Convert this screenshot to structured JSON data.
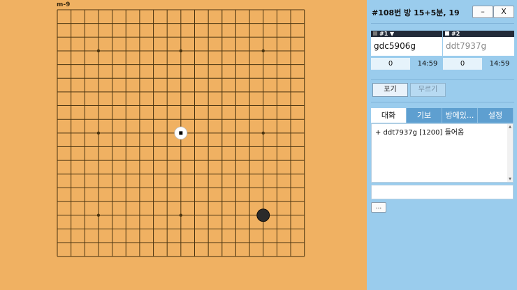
{
  "board": {
    "move_label": "m-9",
    "size": 19,
    "star_points": [
      [
        3,
        3
      ],
      [
        9,
        3
      ],
      [
        15,
        3
      ],
      [
        3,
        9
      ],
      [
        9,
        9
      ],
      [
        15,
        9
      ],
      [
        3,
        15
      ],
      [
        9,
        15
      ],
      [
        15,
        15
      ]
    ],
    "stones": [
      {
        "col": 9,
        "row": 9,
        "color": "white",
        "last_move": true
      },
      {
        "col": 15,
        "row": 15,
        "color": "black",
        "last_move": false
      }
    ],
    "colors": {
      "board": "#f0b162",
      "line": "#4a3410",
      "black": "#2a2a2a",
      "white": "#ffffff"
    }
  },
  "panel": {
    "room_title": "#108번 방   15+5분, 19",
    "min_label": "–",
    "close_label": "X",
    "players": [
      {
        "tag": "#1 ▼",
        "name": "gdc5906g",
        "captures": "0",
        "clock": "14:59"
      },
      {
        "tag": "#2",
        "name": "ddt7937g",
        "captures": "0",
        "clock": "14:59"
      }
    ],
    "resign_label": "포기",
    "undo_label": "무르기",
    "tabs": [
      "대화",
      "기보",
      "방에있...",
      "설정"
    ],
    "chat_lines": [
      "+ ddt7937g [1200] 들어옴"
    ],
    "chat_input_value": "",
    "more_label": "...",
    "colors": {
      "panel": "#9acced",
      "tab": "#5e9fd0"
    }
  }
}
